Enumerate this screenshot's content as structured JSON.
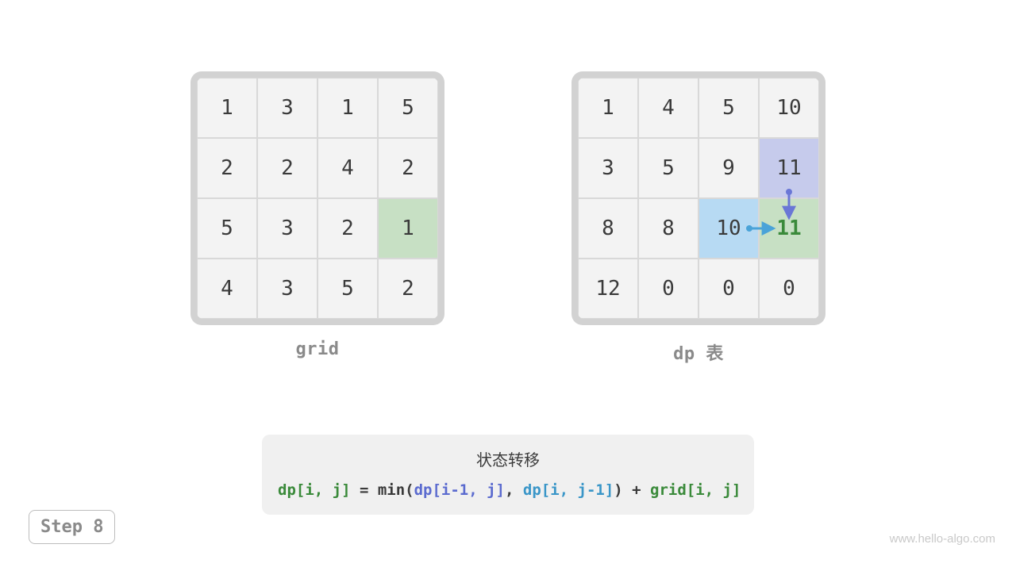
{
  "step_label": "Step 8",
  "watermark": "www.hello-algo.com",
  "grid_label": "grid",
  "dp_label": "dp 表",
  "grid_values": [
    [
      1,
      3,
      1,
      5
    ],
    [
      2,
      2,
      4,
      2
    ],
    [
      5,
      3,
      2,
      1
    ],
    [
      4,
      3,
      5,
      2
    ]
  ],
  "grid_highlight": {
    "r": 2,
    "c": 3,
    "class": "hl-green"
  },
  "dp_values": [
    [
      1,
      4,
      5,
      10
    ],
    [
      3,
      5,
      9,
      11
    ],
    [
      8,
      8,
      10,
      11
    ],
    [
      12,
      0,
      0,
      0
    ]
  ],
  "dp_highlights": [
    {
      "r": 1,
      "c": 3,
      "class": "hl-purple"
    },
    {
      "r": 2,
      "c": 2,
      "class": "hl-blue"
    },
    {
      "r": 2,
      "c": 3,
      "class": "hl-green bold-green"
    }
  ],
  "formula": {
    "title": "状态转移",
    "lhs": "dp[i, j]",
    "eq": " = min(",
    "a": "dp[i-1, j]",
    "sep": ", ",
    "b": "dp[i, j-1]",
    "mid": ") + ",
    "rhs": "grid[i, j]"
  },
  "arrows": {
    "color_top": "#6a77d6",
    "color_left": "#4aa3d8"
  }
}
